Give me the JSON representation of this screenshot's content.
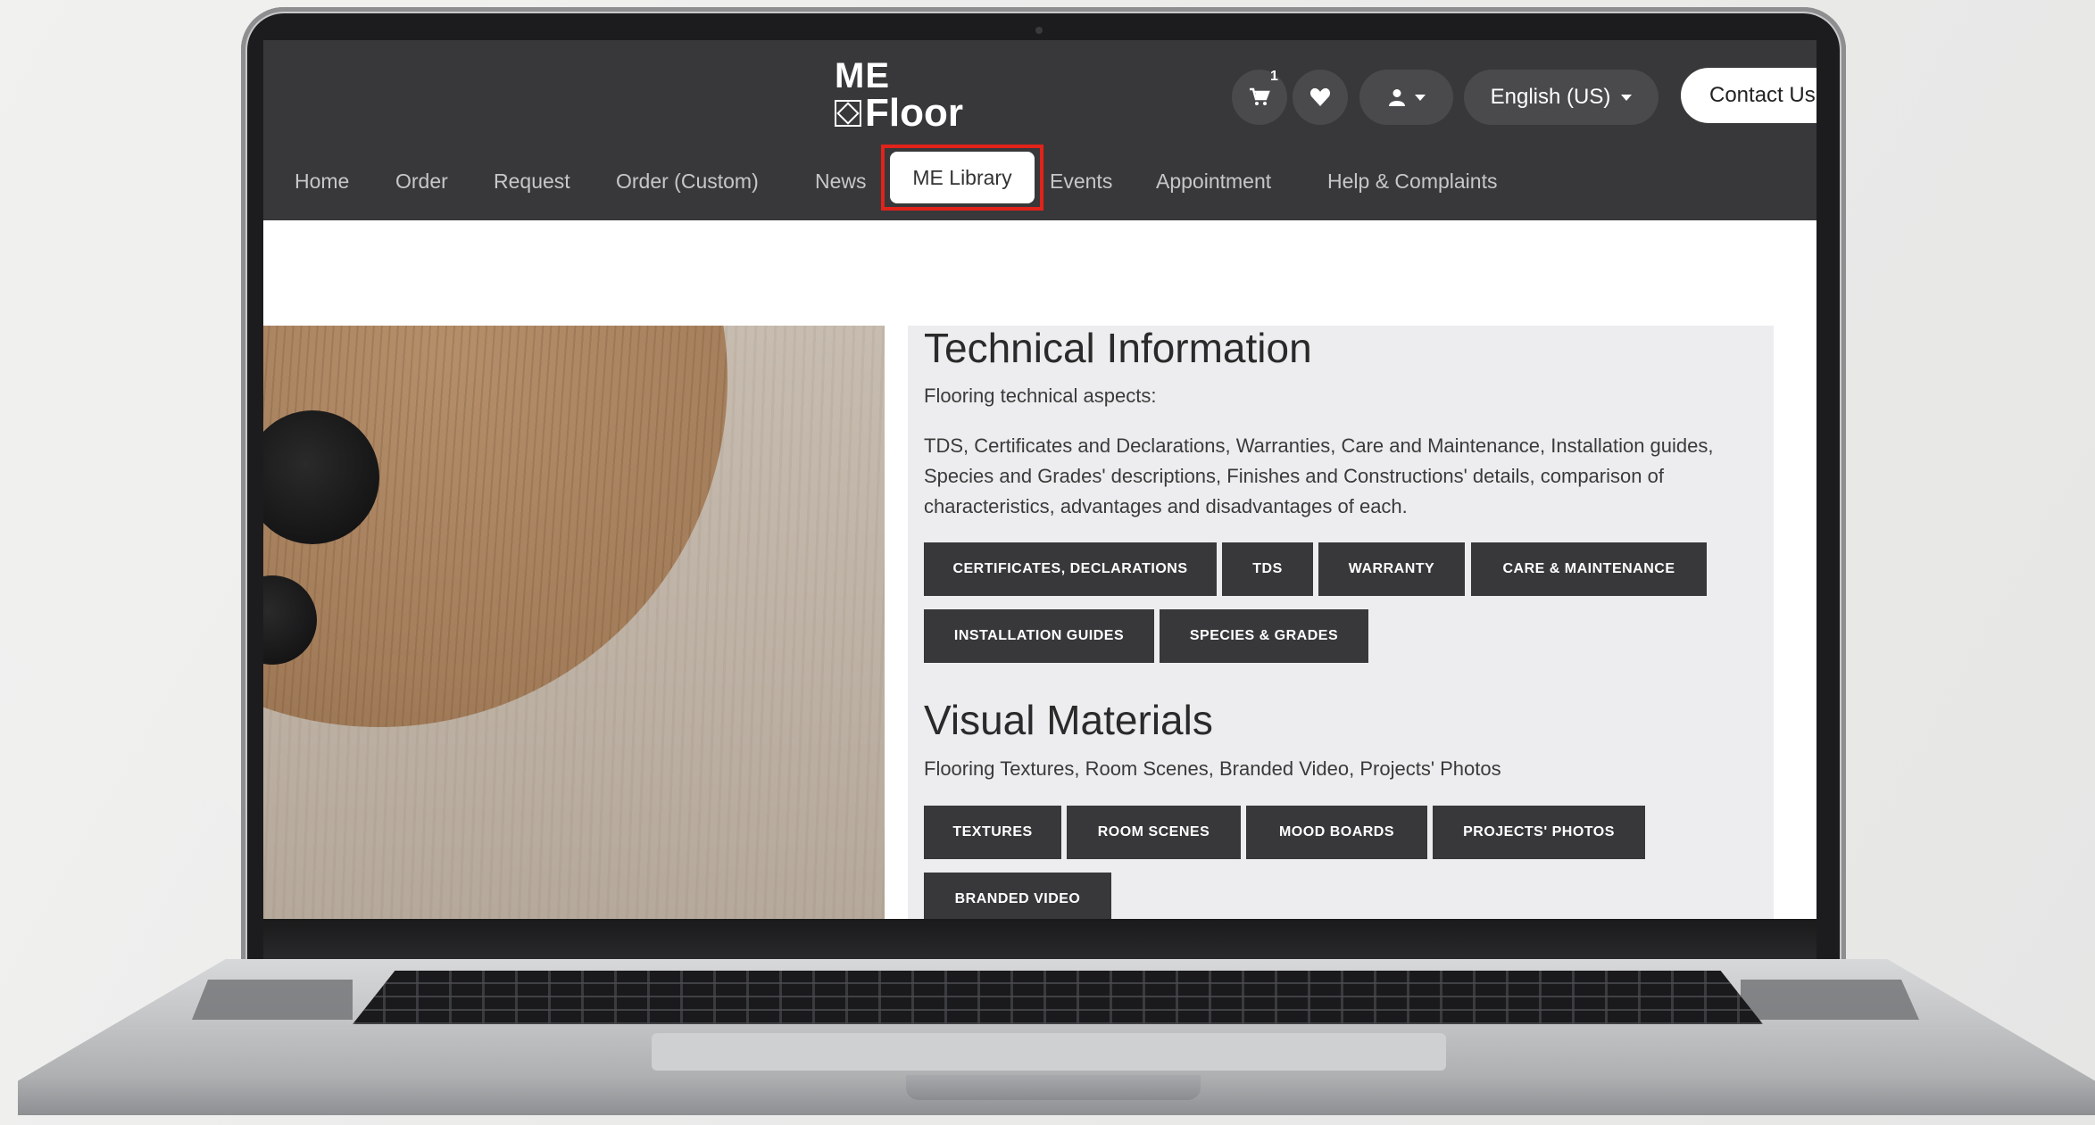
{
  "site": {
    "logo_line1": "ME",
    "logo_line2": "Floor",
    "cart_count": "1",
    "language": "English (US)",
    "contact_label": "Contact Us"
  },
  "nav": {
    "items": [
      "Home",
      "Order",
      "Request",
      "Order (Custom)",
      "News",
      "ME Library",
      "Events",
      "Appointment",
      "Help & Complaints"
    ],
    "active": "ME Library"
  },
  "technical": {
    "title": "Technical Information",
    "subtitle": "Flooring technical aspects:",
    "description": "TDS, Certificates and Declarations, Warranties, Care and Maintenance, Installation guides, Species and Grades' descriptions, Finishes and Constructions' details, comparison of characteristics, advantages and disadvantages of each.",
    "buttons": [
      "CERTIFICATES, DECLARATIONS",
      "TDS",
      "WARRANTY",
      "CARE & MAINTENANCE",
      "INSTALLATION GUIDES",
      "SPECIES & GRADES"
    ]
  },
  "visual": {
    "title": "Visual Materials",
    "subtitle": "Flooring Textures, Room Scenes, Branded Video, Projects' Photos",
    "buttons": [
      "TEXTURES",
      "ROOM SCENES",
      "MOOD BOARDS",
      "PROJECTS' PHOTOS",
      "BRANDED VIDEO"
    ]
  },
  "icons": {
    "cart": "cart-icon",
    "wishlist": "heart-icon",
    "account": "user-icon"
  },
  "colors": {
    "header": "#38383a",
    "highlight": "#e2231a",
    "button": "#38383a"
  }
}
